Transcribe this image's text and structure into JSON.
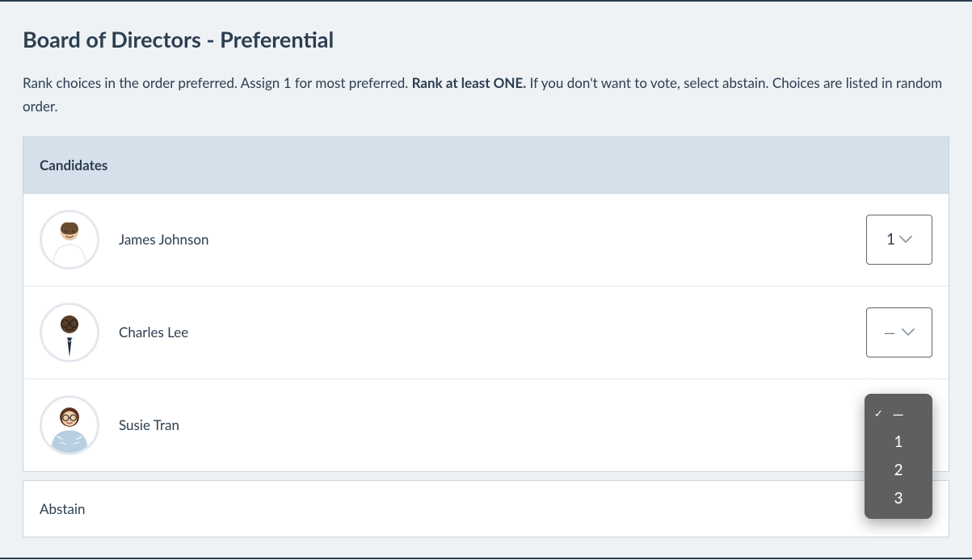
{
  "title": "Board of Directors - Preferential",
  "instructions": {
    "part1": "Rank choices in the order preferred. Assign 1 for most preferred. ",
    "strong": "Rank at least ONE.",
    "part2": " If you don't want to vote, select abstain. Choices are listed in random order."
  },
  "table_header": "Candidates",
  "candidates": [
    {
      "name": "James Johnson",
      "rank": "1"
    },
    {
      "name": "Charles Lee",
      "rank": "—"
    },
    {
      "name": "Susie Tran",
      "rank": ""
    }
  ],
  "abstain_label": "Abstain",
  "dropdown": {
    "placeholder": "—",
    "options": [
      "1",
      "2",
      "3"
    ]
  }
}
